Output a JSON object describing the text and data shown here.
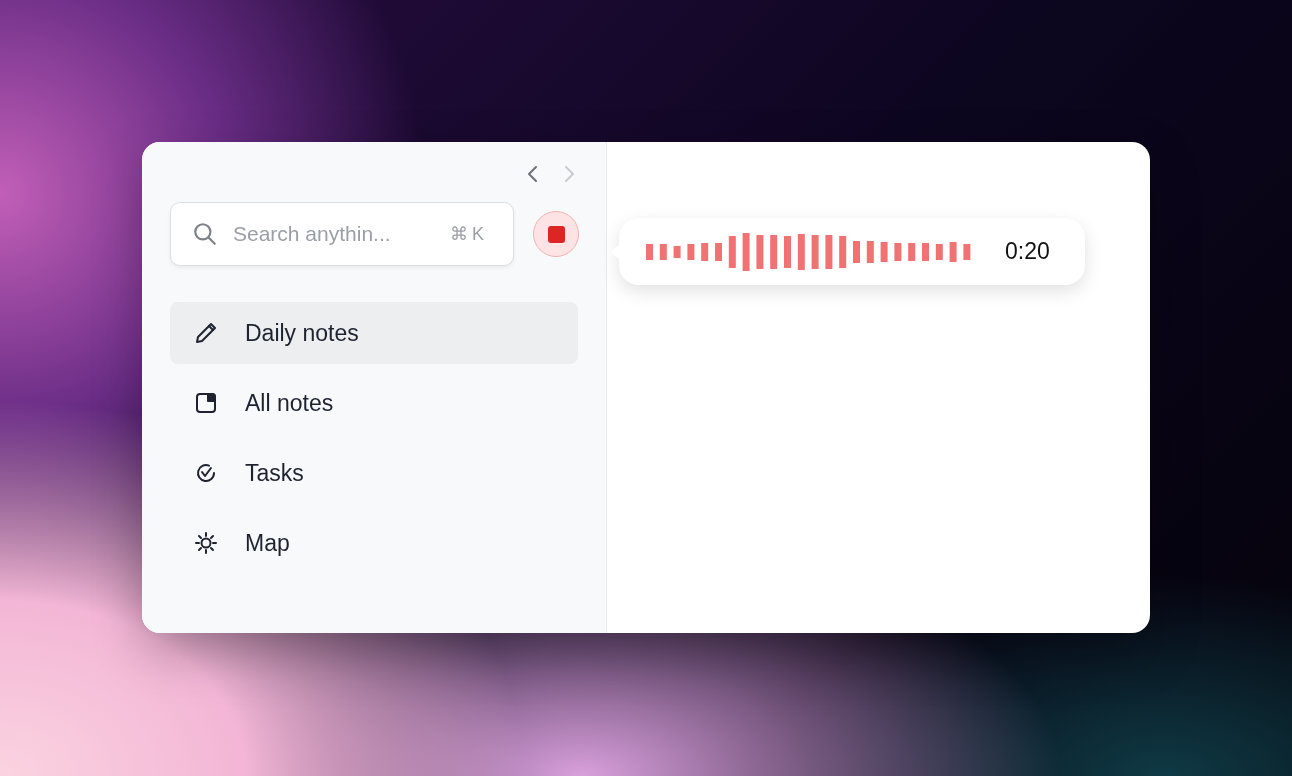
{
  "navigation": {
    "back": {
      "disabled": false
    },
    "forward": {
      "disabled": true
    }
  },
  "search": {
    "placeholder": "Search anythin...",
    "shortcut": "⌘K"
  },
  "recorder": {
    "recording": true,
    "elapsed": "0:20"
  },
  "sidebar": {
    "items": [
      {
        "label": "Daily notes",
        "selected": true
      },
      {
        "label": "All notes",
        "selected": false
      },
      {
        "label": "Tasks",
        "selected": false
      },
      {
        "label": "Map",
        "selected": false
      }
    ]
  }
}
